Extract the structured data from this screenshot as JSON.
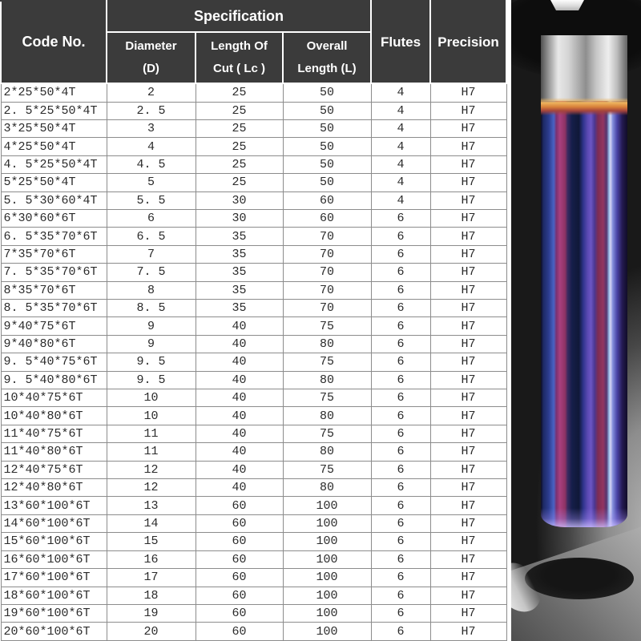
{
  "table": {
    "headers": {
      "code": "Code No.",
      "spec": "Specification",
      "diameter_line1": "Diameter",
      "diameter_line2": "(D)",
      "cut_line1": "Length Of",
      "cut_line2": "Cut ( Lc )",
      "overall_line1": "Overall",
      "overall_line2": "Length (L)",
      "flutes": "Flutes",
      "precision": "Precision"
    },
    "column_keys": [
      "code",
      "diameter",
      "length-of-cut",
      "overall-length",
      "flutes",
      "precision"
    ],
    "rows": [
      [
        "2*25*50*4T",
        "2",
        "25",
        "50",
        "4",
        "H7"
      ],
      [
        "2. 5*25*50*4T",
        "2. 5",
        "25",
        "50",
        "4",
        "H7"
      ],
      [
        "3*25*50*4T",
        "3",
        "25",
        "50",
        "4",
        "H7"
      ],
      [
        "4*25*50*4T",
        "4",
        "25",
        "50",
        "4",
        "H7"
      ],
      [
        "4. 5*25*50*4T",
        "4. 5",
        "25",
        "50",
        "4",
        "H7"
      ],
      [
        "5*25*50*4T",
        "5",
        "25",
        "50",
        "4",
        "H7"
      ],
      [
        "5. 5*30*60*4T",
        "5. 5",
        "30",
        "60",
        "4",
        "H7"
      ],
      [
        "6*30*60*6T",
        "6",
        "30",
        "60",
        "6",
        "H7"
      ],
      [
        "6. 5*35*70*6T",
        "6. 5",
        "35",
        "70",
        "6",
        "H7"
      ],
      [
        "7*35*70*6T",
        "7",
        "35",
        "70",
        "6",
        "H7"
      ],
      [
        "7. 5*35*70*6T",
        "7. 5",
        "35",
        "70",
        "6",
        "H7"
      ],
      [
        "8*35*70*6T",
        "8",
        "35",
        "70",
        "6",
        "H7"
      ],
      [
        "8. 5*35*70*6T",
        "8. 5",
        "35",
        "70",
        "6",
        "H7"
      ],
      [
        "9*40*75*6T",
        "9",
        "40",
        "75",
        "6",
        "H7"
      ],
      [
        "9*40*80*6T",
        "9",
        "40",
        "80",
        "6",
        "H7"
      ],
      [
        "9. 5*40*75*6T",
        "9. 5",
        "40",
        "75",
        "6",
        "H7"
      ],
      [
        "9. 5*40*80*6T",
        "9. 5",
        "40",
        "80",
        "6",
        "H7"
      ],
      [
        "10*40*75*6T",
        "10",
        "40",
        "75",
        "6",
        "H7"
      ],
      [
        "10*40*80*6T",
        "10",
        "40",
        "80",
        "6",
        "H7"
      ],
      [
        "11*40*75*6T",
        "11",
        "40",
        "75",
        "6",
        "H7"
      ],
      [
        "11*40*80*6T",
        "11",
        "40",
        "80",
        "6",
        "H7"
      ],
      [
        "12*40*75*6T",
        "12",
        "40",
        "75",
        "6",
        "H7"
      ],
      [
        "12*40*80*6T",
        "12",
        "40",
        "80",
        "6",
        "H7"
      ],
      [
        "13*60*100*6T",
        "13",
        "60",
        "100",
        "6",
        "H7"
      ],
      [
        "14*60*100*6T",
        "14",
        "60",
        "100",
        "6",
        "H7"
      ],
      [
        "15*60*100*6T",
        "15",
        "60",
        "100",
        "6",
        "H7"
      ],
      [
        "16*60*100*6T",
        "16",
        "60",
        "100",
        "6",
        "H7"
      ],
      [
        "17*60*100*6T",
        "17",
        "60",
        "100",
        "6",
        "H7"
      ],
      [
        "18*60*100*6T",
        "18",
        "60",
        "100",
        "6",
        "H7"
      ],
      [
        "19*60*100*6T",
        "19",
        "60",
        "100",
        "6",
        "H7"
      ],
      [
        "20*60*100*6T",
        "20",
        "60",
        "100",
        "6",
        "H7"
      ]
    ],
    "style": {
      "header_bg": "#3b3b3b",
      "header_text": "#ffffff",
      "grid_line": "#8c8c8c",
      "cell_text": "#2b2b2b"
    }
  },
  "photo": {
    "description": "blue nano-coated carbide reamer held in machine spindle above a bored hole in a steel workpiece",
    "palette": {
      "background_dark": "#191919",
      "shank_silver": "#d9d9d9",
      "heat_band_orange": "#d8813a",
      "coating_blue": "#2c3c8e",
      "coating_magenta": "#a8407e",
      "coating_violet": "#5a49b2",
      "highlight_cyan": "#9cc2ee",
      "plate_gray": "#8f8f8f",
      "hole_black": "#1d1d1d"
    }
  }
}
